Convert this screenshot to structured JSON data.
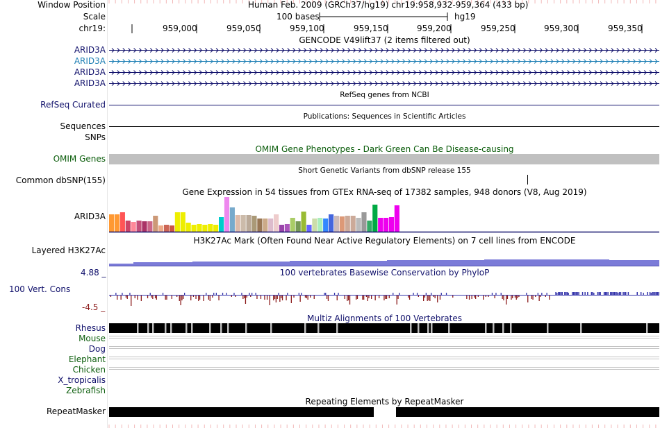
{
  "header": {
    "position_label": "Window Position",
    "scale_label": "Scale",
    "chrom_label": "chr19:",
    "title": "Human Feb. 2009 (GRCh37/hg19)   chr19:958,932-959,364 (433 bp)",
    "scale_text": "100 bases",
    "assembly": "hg19",
    "ticks": [
      "959,000",
      "959,050",
      "959,100",
      "959,150",
      "959,200",
      "959,250",
      "959,300",
      "959,350"
    ]
  },
  "tracks": {
    "gencode": {
      "title": "GENCODE V49lift37 (2 items filtered out)",
      "items": [
        "ARID3A",
        "ARID3A",
        "ARID3A",
        "ARID3A"
      ]
    },
    "refseq": {
      "title": "RefSeq genes from NCBI",
      "label": "RefSeq Curated"
    },
    "pubs": {
      "title": "Publications: Sequences in Scientific Articles",
      "label": "Sequences"
    },
    "snps": {
      "label": "SNPs"
    },
    "omim": {
      "title": "OMIM Gene Phenotypes - Dark Green Can Be Disease-causing",
      "label": "OMIM Genes"
    },
    "dbsnp": {
      "title": "Short Genetic Variants from dbSNP release 155",
      "label": "Common dbSNP(155)"
    },
    "gtex": {
      "title": "Gene Expression in 54 tissues from GTEx RNA-seq of 17382 samples, 948 donors (V8, Aug 2019)",
      "label": "ARID3A",
      "bars": [
        0.5,
        0.5,
        0.55,
        0.32,
        0.28,
        0.32,
        0.3,
        0.3,
        0.45,
        0.18,
        0.2,
        0.18,
        0.55,
        0.55,
        0.25,
        0.2,
        0.22,
        0.2,
        0.22,
        0.2,
        0.42,
        1.0,
        0.7,
        0.48,
        0.48,
        0.48,
        0.45,
        0.38,
        0.38,
        0.38,
        0.5,
        0.2,
        0.22,
        0.4,
        0.3,
        0.58,
        0.2,
        0.38,
        0.4,
        0.38,
        0.5,
        0.46,
        0.44,
        0.45,
        0.45,
        0.4,
        0.55,
        0.32,
        0.78,
        0.4,
        0.4,
        0.42,
        0.75
      ],
      "colors": [
        "#ff9933",
        "#ff9933",
        "#ff5555",
        "#cc4466",
        "#ff8899",
        "#c44f7a",
        "#aa3366",
        "#cc6688",
        "#cc9977",
        "#eeaa88",
        "#cc6655",
        "#cc5544",
        "#eeee00",
        "#eeee00",
        "#eeee00",
        "#eeee00",
        "#eeee00",
        "#eeee00",
        "#eeee00",
        "#eeee00",
        "#00cccc",
        "#ee88ee",
        "#77aacc",
        "#ddbbaa",
        "#ccbbaa",
        "#bbaa99",
        "#aa9977",
        "#997755",
        "#ccaa88",
        "#ddbbcc",
        "#eecccc",
        "#9944aa",
        "#aa55bb",
        "#aacc66",
        "#779955",
        "#99bb33",
        "#6666ff",
        "#ccddaa",
        "#aaeebb",
        "#3388ff",
        "#4466dd",
        "#ccbbbb",
        "#dd9977",
        "#ccaa99",
        "#ccaa99",
        "#bbbbbb",
        "#999999",
        "#33aa66",
        "#00aa44",
        "#ee00ee",
        "#ee00ee",
        "#ee00ee",
        "#ee00ee"
      ]
    },
    "h3k27ac": {
      "title": "H3K27Ac Mark (Often Found Near Active Regulatory Elements) on 7 cell lines from ENCODE",
      "label": "Layered H3K27Ac"
    },
    "phylop": {
      "title": "100 vertebrates Basewise Conservation by PhyloP",
      "label": "100 Vert. Cons",
      "max_label": "4.88 _",
      "min_label": "-4.5 _"
    },
    "multiz": {
      "title": "Multiz Alignments of 100 Vertebrates",
      "species": [
        "Rhesus",
        "Mouse",
        "Dog",
        "Elephant",
        "Chicken",
        "X_tropicalis",
        "Zebrafish"
      ]
    },
    "rmsk": {
      "title": "Repeating Elements by RepeatMasker",
      "label": "RepeatMasker"
    }
  },
  "colors": {
    "navy": "#10106b",
    "label_blue": "#1e7fb4",
    "omim_green": "#0a5c0a",
    "phylop_pos": "#3333aa",
    "phylop_neg": "#8b1a1a",
    "h3k27ac": "#7b7bd8"
  }
}
